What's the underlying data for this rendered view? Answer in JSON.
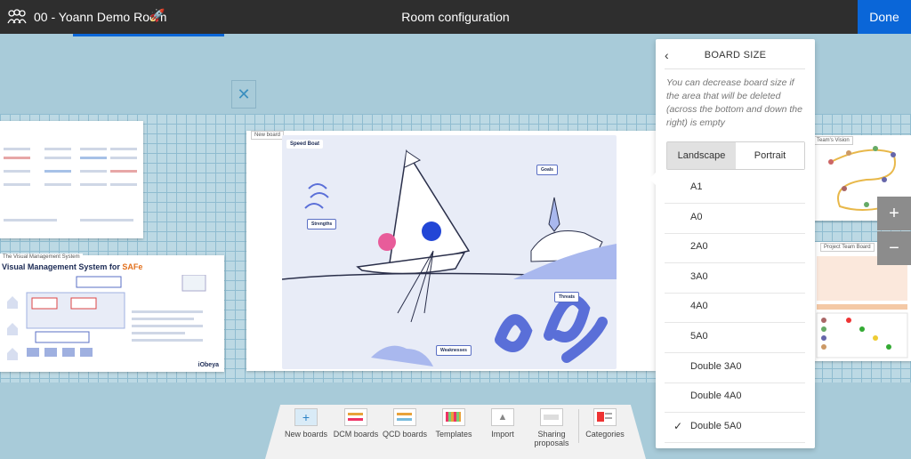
{
  "header": {
    "room_name": "00 - Yoann Demo Room",
    "title": "Room configuration",
    "done_label": "Done"
  },
  "boards": {
    "left_bottom_tag": "The Visual Management System",
    "left_bottom_title_prefix": "Visual Management System for ",
    "left_bottom_title_accent": "SAFe",
    "left_bottom_brand": "iObeya",
    "center_tag": "New board",
    "center_speed": "Speed Boat",
    "center_labels": {
      "goals": "Goals",
      "strengths": "Strengths",
      "threats": "Threats",
      "weaknesses": "Weaknesses"
    },
    "right_top_tag": "Team's Vision",
    "right_bottom_tag": "Project Team Board"
  },
  "popup": {
    "title": "BOARD SIZE",
    "description": "You can decrease board size if the area that will be deleted (across the bottom and down the right) is empty",
    "orientation": {
      "landscape": "Landscape",
      "portrait": "Portrait",
      "selected": "Landscape"
    },
    "sizes": [
      "A1",
      "A0",
      "2A0",
      "3A0",
      "4A0",
      "5A0",
      "Double 3A0",
      "Double 4A0",
      "Double 5A0"
    ],
    "selected_size": "Double 5A0"
  },
  "zoom": {
    "in": "+",
    "out": "−"
  },
  "toolbar": {
    "items": [
      "New boards",
      "DCM boards",
      "QCD boards",
      "Templates",
      "Import",
      "Sharing proposals",
      "Categories"
    ]
  },
  "colors": {
    "accent": "#0a66d8",
    "topbar": "#2e2e2e",
    "background": "#a8cbd9"
  }
}
